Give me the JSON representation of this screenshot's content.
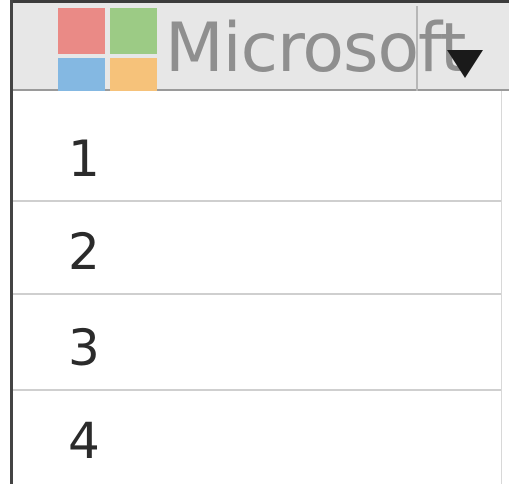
{
  "header": {
    "brand_text": "Microsoft",
    "logo_colors": [
      "#ea8a86",
      "#9ccb85",
      "#84b8e2",
      "#f6c27a"
    ],
    "dropdown_icon": "chevron-down-icon"
  },
  "list": {
    "items": [
      {
        "label": "1"
      },
      {
        "label": "2"
      },
      {
        "label": "3"
      },
      {
        "label": "4"
      }
    ]
  }
}
